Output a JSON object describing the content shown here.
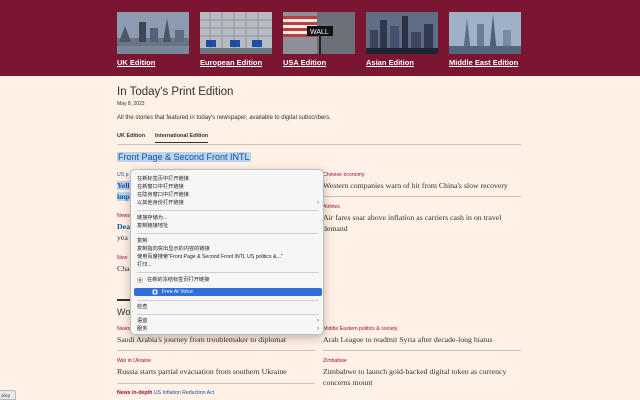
{
  "editions": [
    {
      "label": "UK Edition",
      "thumb": "london-skyline-image"
    },
    {
      "label": "European Edition",
      "thumb": "eu-building-flags-image"
    },
    {
      "label": "USA Edition",
      "thumb": "wall-street-sign-image"
    },
    {
      "label": "Asian Edition",
      "thumb": "asian-city-skyline-image"
    },
    {
      "label": "Middle East Edition",
      "thumb": "middle-east-towers-image"
    }
  ],
  "page": {
    "title": "In Today's Print Edition",
    "date": "May 8, 2023",
    "intro": "All the stories that featured in today's newspaper, available to digital subscribers."
  },
  "tabs": {
    "uk": "UK Edition",
    "international": "International Edition"
  },
  "sections": {
    "front": "Front Page & Second Front INTL",
    "world": "Wo"
  },
  "left_peek": {
    "tag1": "US p",
    "line1a": "Yell",
    "line1b": "imp",
    "tag2": "News",
    "line2a": "Dea",
    "line2b": "yea",
    "tag3": "New",
    "line3": "Cha"
  },
  "articles_right_top": [
    {
      "tag": "Chinese economy",
      "headline": "Western companies warn of hit from China's slow recovery"
    },
    {
      "tag": "Airlines",
      "headline": "Air fares soar above inflation as carriers cash in on travel demand"
    }
  ],
  "articles_world": [
    {
      "tag": "News",
      "tag_suffix": "",
      "headline": "Saudi Arabia's journey from troublemaker to diplomat"
    },
    {
      "tag": "Middle Eastern politics & society",
      "tag_suffix": "",
      "headline": "Arab League to readmit Syria after decade-long hiatus"
    },
    {
      "tag": "War in Ukraine",
      "tag_suffix": "",
      "headline": "Russia starts partial evacuation from southern Ukraine"
    },
    {
      "tag": "Zimbabwe",
      "tag_suffix": "",
      "headline": "Zimbabwe to launch gold-backed digital token as currency concerns mount"
    },
    {
      "tag": "News in-depth",
      "tag_suffix": "US Inflation Reduction Act",
      "headline": ""
    }
  ],
  "context_menu": {
    "items": [
      {
        "label": "在新标签页中打开链接"
      },
      {
        "label": "在新窗口中打开链接"
      },
      {
        "label": "在隐身窗口中打开链接"
      },
      {
        "label": "以其他身份打开链接",
        "submenu": true
      },
      {
        "label": "链接存储为..."
      },
      {
        "label": "复制链接地址"
      },
      {
        "label": "复制"
      },
      {
        "label": "复制指向突出显示的内容的链接"
      },
      {
        "label": "使用百度搜索\"Front Page & Second Front INTL US politics &...\""
      },
      {
        "label": "打印..."
      },
      {
        "label": "在新的冻结标签页打开链接",
        "icon": "extension-icon"
      },
      {
        "label": "Free AI Voice",
        "highlighted": true,
        "icon": "voice-icon"
      },
      {
        "label": "检查"
      },
      {
        "label": "语音",
        "submenu": true
      },
      {
        "label": "服务",
        "submenu": true
      }
    ],
    "highlight_color": "#2f6fd8"
  },
  "corner_badge": "olicy",
  "colors": {
    "band": "#7a1631",
    "page_bg": "#fff1e5",
    "tag_red": "#990f3d",
    "link_blue": "#0f5499",
    "selection": "#bcd3ee"
  }
}
